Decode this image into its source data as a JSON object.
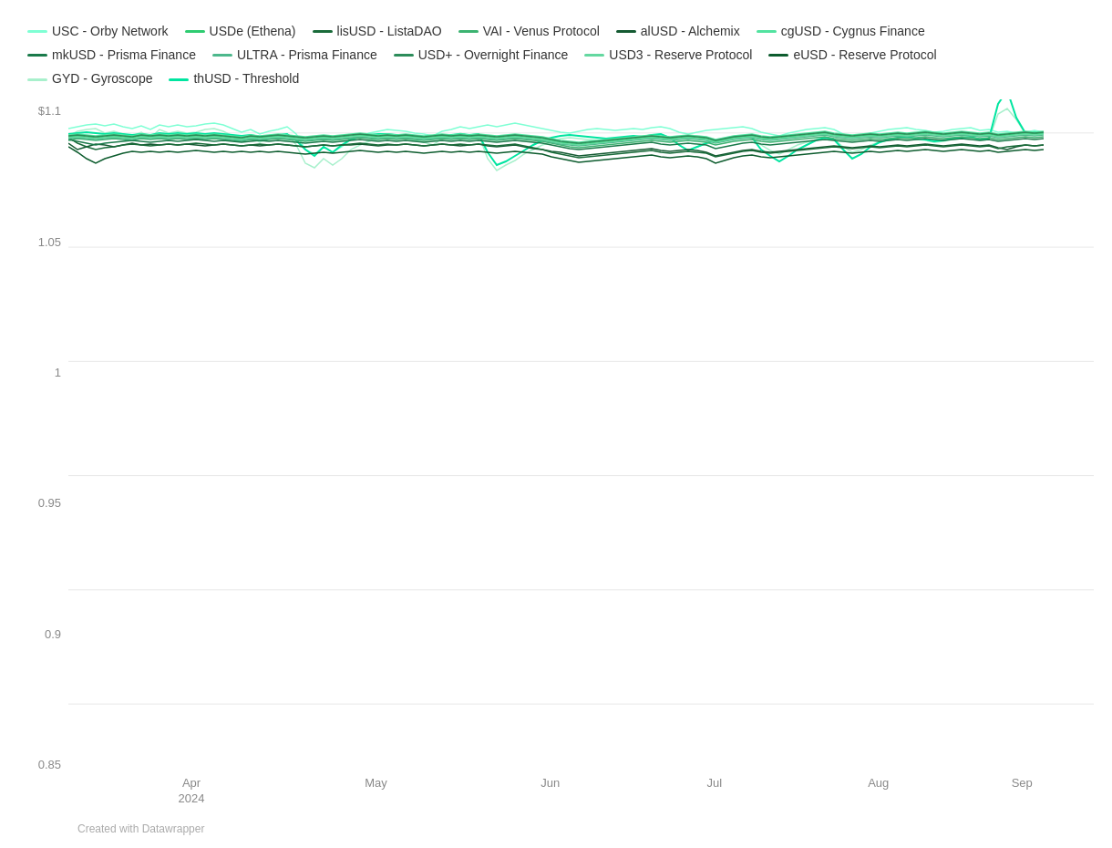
{
  "legend": {
    "items": [
      {
        "label": "USC - Orby Network",
        "color": "#7fffd4"
      },
      {
        "label": "USDe (Ethena)",
        "color": "#2ecc71"
      },
      {
        "label": "lisUSD - ListaDAO",
        "color": "#1a6b3a"
      },
      {
        "label": "VAI - Venus Protocol",
        "color": "#3cb371"
      },
      {
        "label": "alUSD - Alchemix",
        "color": "#145a32"
      },
      {
        "label": "cgUSD - Cygnus Finance",
        "color": "#52e3a0"
      },
      {
        "label": "mkUSD - Prisma Finance",
        "color": "#1a7a4a"
      },
      {
        "label": "ULTRA - Prisma Finance",
        "color": "#4db88c"
      },
      {
        "label": "USD+ - Overnight Finance",
        "color": "#2c8c5a"
      },
      {
        "label": "USD3 - Reserve Protocol",
        "color": "#64d8a0"
      },
      {
        "label": "eUSD - Reserve Protocol",
        "color": "#0d5c2e"
      },
      {
        "label": "GYD - Gyroscope",
        "color": "#a8f0cc"
      },
      {
        "label": "thUSD - Threshold",
        "color": "#00e5a0"
      }
    ]
  },
  "yAxis": {
    "labels": [
      "$1.1",
      "1.05",
      "1",
      "0.95",
      "0.9",
      "0.85"
    ]
  },
  "xAxis": {
    "labels": [
      {
        "text": "Apr\n2024",
        "pos": 0.12
      },
      {
        "text": "May",
        "pos": 0.3
      },
      {
        "text": "Jun",
        "pos": 0.47
      },
      {
        "text": "Jul",
        "pos": 0.63
      },
      {
        "text": "Aug",
        "pos": 0.79
      },
      {
        "text": "Sep",
        "pos": 0.93
      }
    ]
  },
  "footer": {
    "text": "Created with Datawrapper"
  }
}
